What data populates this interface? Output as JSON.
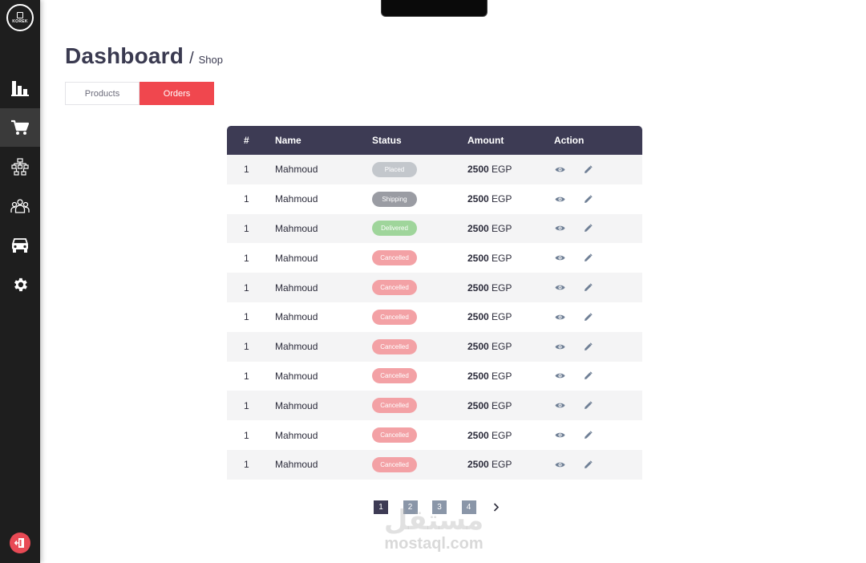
{
  "sidebar": {
    "logo_text": "KOREK",
    "items": [
      {
        "name": "reports",
        "icon": "bar-chart-icon"
      },
      {
        "name": "shop",
        "icon": "cart-icon",
        "active": true
      },
      {
        "name": "hierarchy",
        "icon": "org-tree-icon"
      },
      {
        "name": "users",
        "icon": "users-group-icon"
      },
      {
        "name": "vehicles",
        "icon": "car-icon"
      },
      {
        "name": "settings",
        "icon": "gear-icon"
      }
    ],
    "logout_icon": "logout-icon"
  },
  "header": {
    "title": "Dashboard",
    "separator": "/",
    "breadcrumb": "Shop"
  },
  "tabs": [
    {
      "label": "Products",
      "active": false
    },
    {
      "label": "Orders",
      "active": true
    }
  ],
  "table": {
    "columns": [
      "#",
      "Name",
      "Status",
      "Amount",
      "Action"
    ],
    "status_colors": {
      "Placed": "#c3c7cc",
      "Shipping": "#9a9ca3",
      "Delivered": "#9fd59b",
      "Cancelled": "#f3a1a5"
    },
    "rows": [
      {
        "num": "1",
        "name": "Mahmoud",
        "status": "Placed",
        "amount": "2500",
        "currency": "EGP"
      },
      {
        "num": "1",
        "name": "Mahmoud",
        "status": "Shipping",
        "amount": "2500",
        "currency": "EGP"
      },
      {
        "num": "1",
        "name": "Mahmoud",
        "status": "Delivered",
        "amount": "2500",
        "currency": "EGP"
      },
      {
        "num": "1",
        "name": "Mahmoud",
        "status": "Cancelled",
        "amount": "2500",
        "currency": "EGP"
      },
      {
        "num": "1",
        "name": "Mahmoud",
        "status": "Cancelled",
        "amount": "2500",
        "currency": "EGP"
      },
      {
        "num": "1",
        "name": "Mahmoud",
        "status": "Cancelled",
        "amount": "2500",
        "currency": "EGP"
      },
      {
        "num": "1",
        "name": "Mahmoud",
        "status": "Cancelled",
        "amount": "2500",
        "currency": "EGP"
      },
      {
        "num": "1",
        "name": "Mahmoud",
        "status": "Cancelled",
        "amount": "2500",
        "currency": "EGP"
      },
      {
        "num": "1",
        "name": "Mahmoud",
        "status": "Cancelled",
        "amount": "2500",
        "currency": "EGP"
      },
      {
        "num": "1",
        "name": "Mahmoud",
        "status": "Cancelled",
        "amount": "2500",
        "currency": "EGP"
      },
      {
        "num": "1",
        "name": "Mahmoud",
        "status": "Cancelled",
        "amount": "2500",
        "currency": "EGP"
      }
    ]
  },
  "pagination": {
    "pages": [
      "1",
      "2",
      "3",
      "4"
    ],
    "current": "1",
    "next_icon": "chevron-right-icon"
  },
  "watermark": {
    "arabic": "مستقل",
    "latin": "mostaql.com"
  },
  "colors": {
    "accent": "#f0474e",
    "header_dark": "#3d3b54",
    "sidebar": "#1e1e1e"
  }
}
